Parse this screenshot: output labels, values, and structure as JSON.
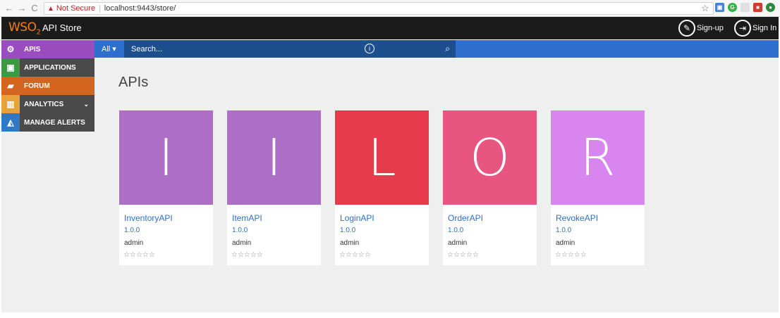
{
  "browser": {
    "back": "←",
    "forward": "→",
    "reload": "C",
    "not_secure": "Not Secure",
    "url": "localhost:9443/store/",
    "star": "☆"
  },
  "header": {
    "logo_text": "WSO",
    "logo_sub": "2",
    "brand": "API Store",
    "signup": "Sign-up",
    "signin": "Sign In"
  },
  "search": {
    "scope": "All ▾",
    "placeholder": "Search..."
  },
  "sidebar": {
    "items": [
      {
        "label": "APIS",
        "color": "#9b4dbf",
        "icon": "gear-icon"
      },
      {
        "label": "APPLICATIONS",
        "color": "#4a4a4a",
        "icon": "window-icon"
      },
      {
        "label": "FORUM",
        "color": "#d4651f",
        "icon": "chat-icon"
      },
      {
        "label": "ANALYTICS",
        "color": "#4a4a4a",
        "icon": "chart-icon"
      },
      {
        "label": "MANAGE ALERTS",
        "color": "#4a4a4a",
        "icon": "bell-icon"
      }
    ]
  },
  "main": {
    "title": "APIs",
    "cards": [
      {
        "letter": "I",
        "name": "InventoryAPI",
        "version": "1.0.0",
        "owner": "admin",
        "rating": "☆☆☆☆☆",
        "color": "#ad6ec6"
      },
      {
        "letter": "I",
        "name": "ItemAPI",
        "version": "1.0.0",
        "owner": "admin",
        "rating": "☆☆☆☆☆",
        "color": "#ad6ec6"
      },
      {
        "letter": "L",
        "name": "LoginAPI",
        "version": "1.0.0",
        "owner": "admin",
        "rating": "☆☆☆☆☆",
        "color": "#e83a4d"
      },
      {
        "letter": "O",
        "name": "OrderAPI",
        "version": "1.0.0",
        "owner": "admin",
        "rating": "☆☆☆☆☆",
        "color": "#e95581"
      },
      {
        "letter": "R",
        "name": "RevokeAPI",
        "version": "1.0.0",
        "owner": "admin",
        "rating": "☆☆☆☆☆",
        "color": "#d985ef"
      }
    ]
  }
}
